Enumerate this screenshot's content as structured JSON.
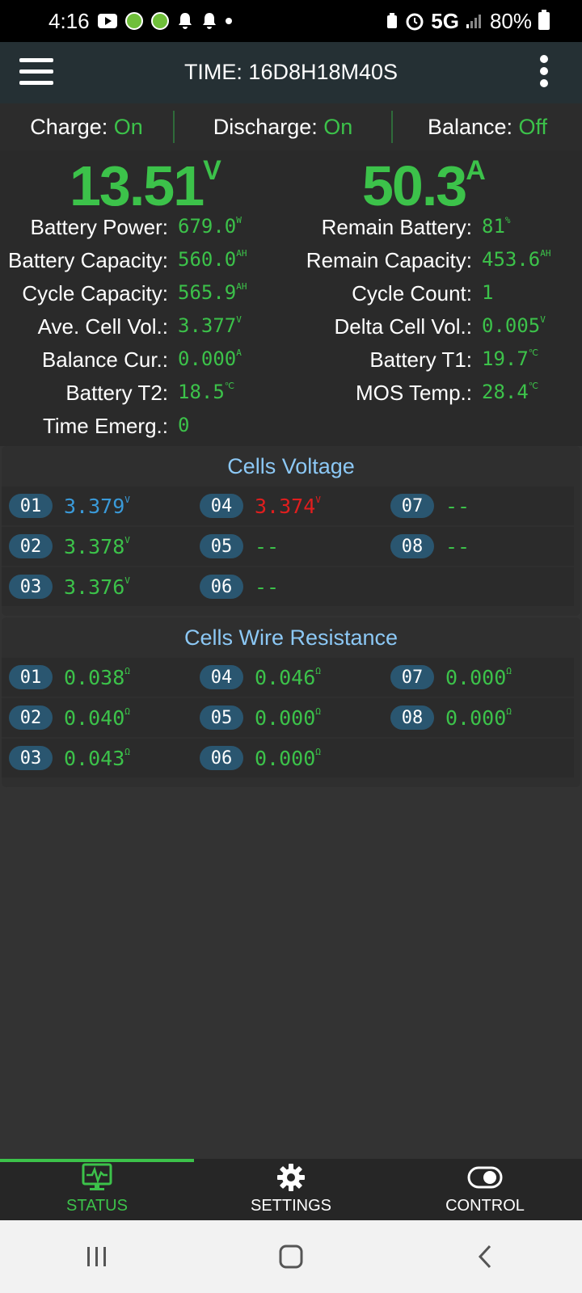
{
  "status_bar": {
    "time": "4:16",
    "network": "5G",
    "battery": "80%"
  },
  "header": {
    "title": "TIME: 16D8H18M40S"
  },
  "states": [
    {
      "label": "Charge: ",
      "value": "On"
    },
    {
      "label": "Discharge: ",
      "value": "On"
    },
    {
      "label": "Balance: ",
      "value": "Off"
    }
  ],
  "voltage": {
    "value": "13.51",
    "unit": "V"
  },
  "current": {
    "value": "50.3",
    "unit": "A"
  },
  "left_rows": [
    {
      "label": "Battery Power:",
      "value": "679.0",
      "unit": "W"
    },
    {
      "label": "Battery Capacity:",
      "value": "560.0",
      "unit": "AH"
    },
    {
      "label": "Cycle Capacity:",
      "value": "565.9",
      "unit": "AH"
    },
    {
      "label": "Ave. Cell Vol.:",
      "value": "3.377",
      "unit": "V"
    },
    {
      "label": "Balance Cur.:",
      "value": "0.000",
      "unit": "A"
    },
    {
      "label": "Battery T2:",
      "value": "18.5",
      "unit": "℃"
    },
    {
      "label": "Time Emerg.:",
      "value": "0",
      "unit": ""
    }
  ],
  "right_rows": [
    {
      "label": "Remain Battery:",
      "value": "81",
      "unit": "%"
    },
    {
      "label": "Remain Capacity:",
      "value": "453.6",
      "unit": "AH"
    },
    {
      "label": "Cycle Count:",
      "value": "1",
      "unit": ""
    },
    {
      "label": "Delta Cell Vol.:",
      "value": "0.005",
      "unit": "V"
    },
    {
      "label": "Battery T1:",
      "value": "19.7",
      "unit": "℃"
    },
    {
      "label": "MOS Temp.:",
      "value": "28.4",
      "unit": "℃"
    }
  ],
  "cells_voltage": {
    "title": "Cells Voltage",
    "cells": [
      {
        "id": "01",
        "value": "3.379",
        "unit": "V",
        "color": "#3a9ad9"
      },
      {
        "id": "04",
        "value": "3.374",
        "unit": "V",
        "color": "#e01e1e"
      },
      {
        "id": "07",
        "value": "--",
        "unit": "",
        "color": "#3cc24a"
      },
      {
        "id": "02",
        "value": "3.378",
        "unit": "V",
        "color": "#3cc24a"
      },
      {
        "id": "05",
        "value": "--",
        "unit": "",
        "color": "#3cc24a"
      },
      {
        "id": "08",
        "value": "--",
        "unit": "",
        "color": "#3cc24a"
      },
      {
        "id": "03",
        "value": "3.376",
        "unit": "V",
        "color": "#3cc24a"
      },
      {
        "id": "06",
        "value": "--",
        "unit": "",
        "color": "#3cc24a"
      }
    ]
  },
  "cells_resistance": {
    "title": "Cells Wire Resistance",
    "cells": [
      {
        "id": "01",
        "value": "0.038",
        "unit": "Ω"
      },
      {
        "id": "04",
        "value": "0.046",
        "unit": "Ω"
      },
      {
        "id": "07",
        "value": "0.000",
        "unit": "Ω"
      },
      {
        "id": "02",
        "value": "0.040",
        "unit": "Ω"
      },
      {
        "id": "05",
        "value": "0.000",
        "unit": "Ω"
      },
      {
        "id": "08",
        "value": "0.000",
        "unit": "Ω"
      },
      {
        "id": "03",
        "value": "0.043",
        "unit": "Ω"
      },
      {
        "id": "06",
        "value": "0.000",
        "unit": "Ω"
      }
    ]
  },
  "bottom_nav": [
    {
      "label": "STATUS",
      "icon": "monitor-icon",
      "active": true
    },
    {
      "label": "SETTINGS",
      "icon": "gear-icon",
      "active": false
    },
    {
      "label": "CONTROL",
      "icon": "toggle-icon",
      "active": false
    }
  ],
  "colors": {
    "accent": "#3cc24a",
    "panel_title": "#8cc8f5",
    "badge": "#2a5670"
  }
}
